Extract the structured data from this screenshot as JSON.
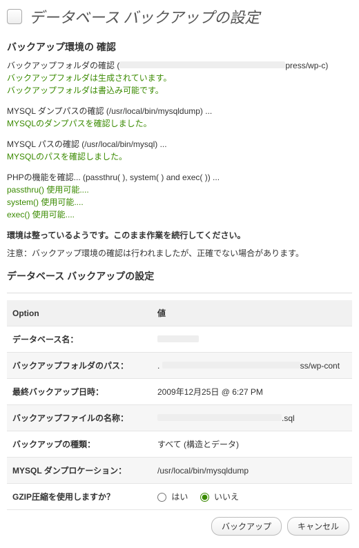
{
  "page_title": "データベース バックアップの設定",
  "env_check": {
    "heading": "バックアップ環境の 確認",
    "folder": {
      "label_prefix": "バックアップフォルダの確認 (",
      "path_visible_suffix": "press/wp-c",
      "label_suffix": ")",
      "line1": "バックアップフォルダは生成されています。",
      "line2": "バックアップフォルダは書込み可能です。"
    },
    "mysqldump": {
      "label": "MYSQL ダンプパスの確認 (/usr/local/bin/mysqldump) ...",
      "line1": "MYSQLのダンプパスを確認しました。"
    },
    "mysql": {
      "label": "MYSQL パスの確認 (/usr/local/bin/mysql) ...",
      "line1": "MYSQLのパスを確認しました。"
    },
    "php": {
      "label": "PHPの機能を確認... (passthru( ), system( ) and exec( )) ...",
      "line1": "passthru() 使用可能....",
      "line2": "system() 使用可能....",
      "line3": "exec() 使用可能...."
    },
    "ready": "環境は整っているようです。このまま作業を続行してください。",
    "note": "注意：バックアップ環境の確認は行われましたが、正確でない場合があります。"
  },
  "settings": {
    "heading": "データベース バックアップの設定",
    "columns": {
      "option": "Option",
      "value": "値"
    },
    "rows": {
      "db_name": {
        "label": "データベース名：",
        "value": "",
        "redacted": true
      },
      "backup_folder": {
        "label": "バックアップフォルダのパス：",
        "value_suffix": "ss/wp-cont"
      },
      "last_backup": {
        "label": "最終バックアップ日時：",
        "value": "2009年12月25日 @ 6:27 PM"
      },
      "backup_filename": {
        "label": "バックアップファイルの名称：",
        "value_suffix": ".sql"
      },
      "backup_type": {
        "label": "バックアップの種類：",
        "value": "すべて (構造とデータ)"
      },
      "mysqldump_location": {
        "label": "MYSQL ダンプロケーション：",
        "value": "/usr/local/bin/mysqldump"
      },
      "gzip": {
        "label": "GZIP圧縮を使用しますか？",
        "options": {
          "yes": "はい",
          "no": "いいえ"
        },
        "selected": "no"
      }
    },
    "buttons": {
      "backup": "バックアップ",
      "cancel": "キャンセル"
    }
  }
}
